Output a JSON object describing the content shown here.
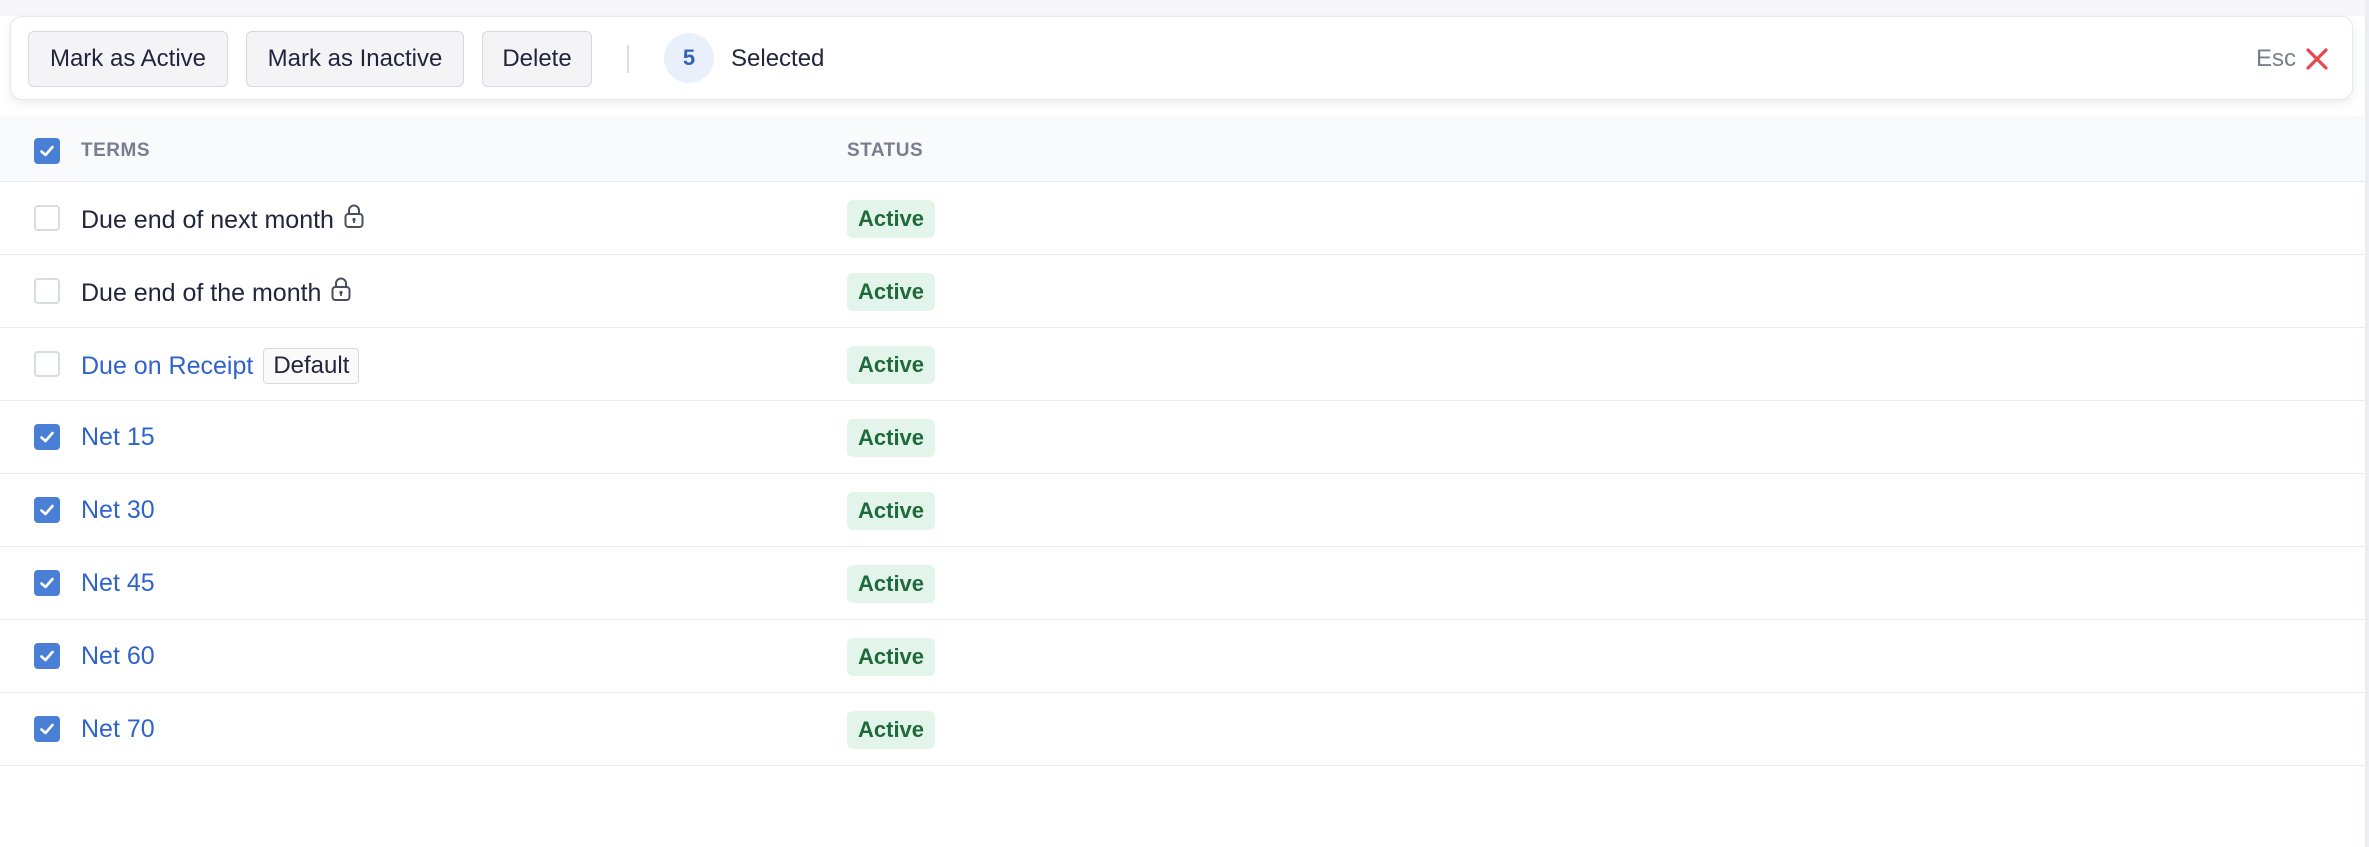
{
  "bulk_bar": {
    "mark_active_label": "Mark as Active",
    "mark_inactive_label": "Mark as Inactive",
    "delete_label": "Delete",
    "selected_count": "5",
    "selected_label": "Selected",
    "esc_label": "Esc"
  },
  "table": {
    "headers": {
      "terms": "TERMS",
      "status": "STATUS"
    },
    "header_checked": true,
    "rows": [
      {
        "term": "Due end of next month",
        "status": "Active",
        "checked": false,
        "locked": true,
        "link": false,
        "tag": ""
      },
      {
        "term": "Due end of the month",
        "status": "Active",
        "checked": false,
        "locked": true,
        "link": false,
        "tag": ""
      },
      {
        "term": "Due on Receipt",
        "status": "Active",
        "checked": false,
        "locked": false,
        "link": true,
        "tag": "Default"
      },
      {
        "term": "Net 15",
        "status": "Active",
        "checked": true,
        "locked": false,
        "link": true,
        "tag": ""
      },
      {
        "term": "Net 30",
        "status": "Active",
        "checked": true,
        "locked": false,
        "link": true,
        "tag": ""
      },
      {
        "term": "Net 45",
        "status": "Active",
        "checked": true,
        "locked": false,
        "link": true,
        "tag": ""
      },
      {
        "term": "Net 60",
        "status": "Active",
        "checked": true,
        "locked": false,
        "link": true,
        "tag": ""
      },
      {
        "term": "Net 70",
        "status": "Active",
        "checked": true,
        "locked": false,
        "link": true,
        "tag": ""
      }
    ]
  },
  "icons": {
    "close": "close-icon",
    "lock": "lock-icon",
    "check": "check-icon"
  },
  "colors": {
    "accent": "#4a7fd6",
    "link": "#2f63cc",
    "close": "#e8474b",
    "active_bg": "#e3f5ea",
    "active_text": "#1f6a3c"
  }
}
